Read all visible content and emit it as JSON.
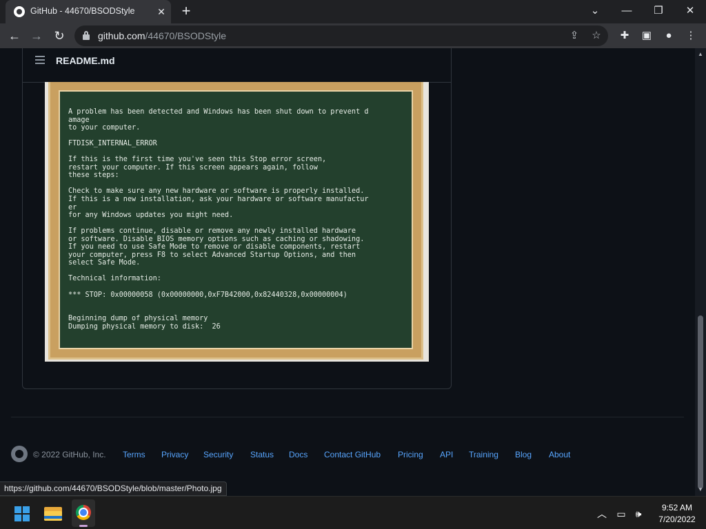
{
  "browser": {
    "tab_title": "GitHub - 44670/BSODStyle",
    "url_host": "github.com",
    "url_path": "/44670/BSODStyle",
    "status_url": "https://github.com/44670/BSODStyle/blob/master/Photo.jpg"
  },
  "readme": {
    "title": "README.md",
    "photo_text": "A problem has been detected and Windows has been shut down to prevent d\namage\nto your computer.\n\nFTDISK_INTERNAL_ERROR\n\nIf this is the first time you've seen this Stop error screen,\nrestart your computer. If this screen appears again, follow\nthese steps:\n\nCheck to make sure any new hardware or software is properly installed.\nIf this is a new installation, ask your hardware or software manufactur\ner\nfor any Windows updates you might need.\n\nIf problems continue, disable or remove any newly installed hardware\nor software. Disable BIOS memory options such as caching or shadowing.\nIf you need to use Safe Mode to remove or disable components, restart\nyour computer, press F8 to select Advanced Startup Options, and then\nselect Safe Mode.\n\nTechnical information:\n\n*** STOP: 0x00000058 (0x00000000,0xF7B42000,0x82440328,0x00000004)\n\n\nBeginning dump of physical memory\nDumping physical memory to disk:  26"
  },
  "footer": {
    "copyright": "© 2022 GitHub, Inc.",
    "links": [
      "Terms",
      "Privacy",
      "Security",
      "Status",
      "Docs",
      "Contact GitHub",
      "Pricing",
      "API",
      "Training",
      "Blog",
      "About"
    ]
  },
  "taskbar": {
    "time": "9:52 AM",
    "date": "7/20/2022"
  },
  "colors": {
    "page_bg": "#0d1117",
    "link": "#58a6ff",
    "chalkboard": "#23402d"
  }
}
